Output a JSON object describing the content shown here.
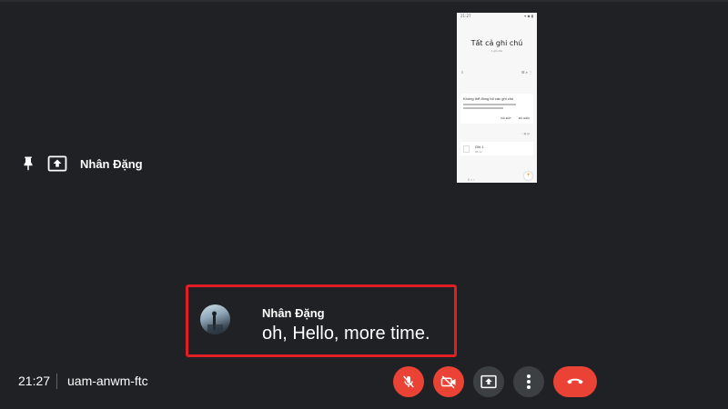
{
  "presenter": {
    "name": "Nhân Đặng",
    "pin_icon": "pin-icon",
    "present_icon": "present-to-all-icon"
  },
  "shared_screen": {
    "status_time": "21:27",
    "status_icons": "▾ ◆ ▮",
    "title": "Tất cả ghi chú",
    "subtitle": "1 ghi chú",
    "toolbar_left": "≡",
    "toolbar_right": "☰ ⌕ ⋮",
    "card_title": "Không thể đồng bộ các ghi chú",
    "card_action_1": "CÀI ĐẶT",
    "card_action_2": "ĐÃ HIỂU",
    "meta": "↓ ▦ ▤",
    "note_title": "Ghi 1",
    "note_date": "08:42",
    "fab": "+",
    "nav": "‖   ○   ‹"
  },
  "caption": {
    "speaker": "Nhân Đặng",
    "text": "oh, Hello, more time."
  },
  "meeting": {
    "time": "21:27",
    "code": "uam-anwm-ftc"
  },
  "controls": {
    "mic_icon": "mic-off-icon",
    "camera_icon": "camera-off-icon",
    "present_icon": "present-now-icon",
    "more_icon": "more-options-icon",
    "leave_icon": "leave-call-icon",
    "accent_red": "#ea4335",
    "button_grey": "#3c4043",
    "highlight_border": "#e01e24"
  }
}
